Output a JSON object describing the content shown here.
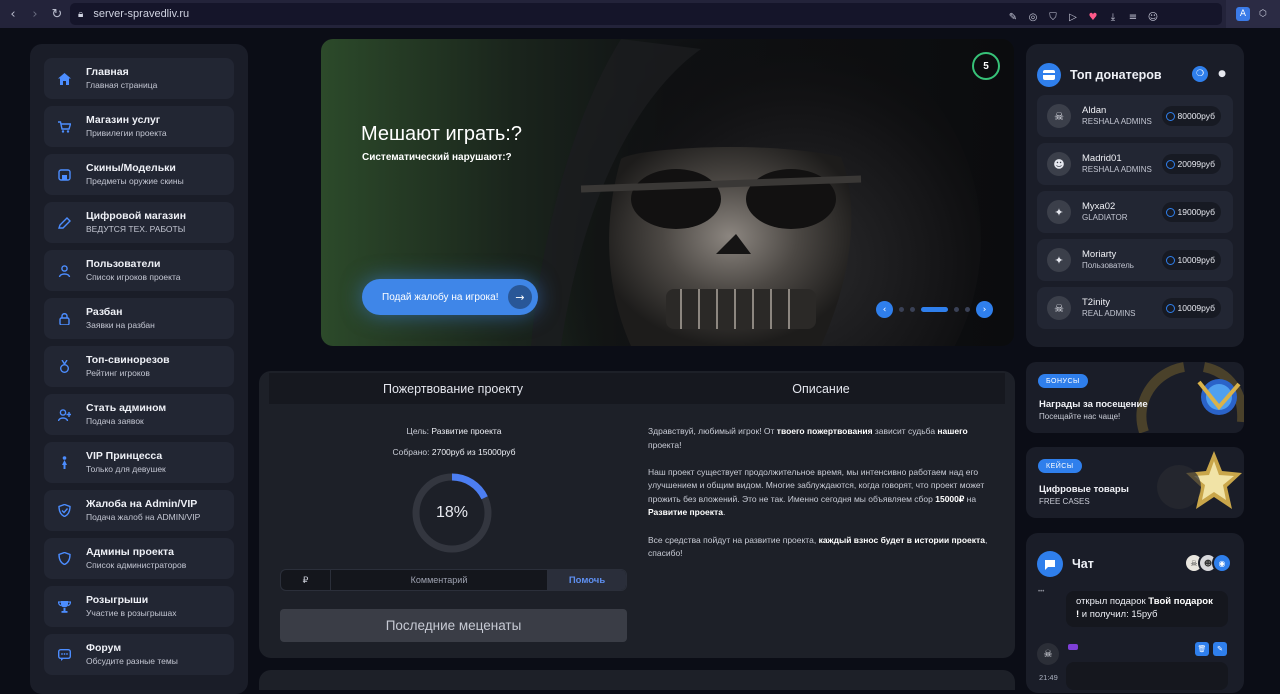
{
  "browser": {
    "url": "server-spravedliv.ru"
  },
  "sidebar": {
    "items": [
      {
        "title": "Главная",
        "subtitle": "Главная страница",
        "icon": "home-icon"
      },
      {
        "title": "Магазин услуг",
        "subtitle": "Привилегии проекта",
        "icon": "cart-icon"
      },
      {
        "title": "Скины/Модельки",
        "subtitle": "Предметы оружие скины",
        "icon": "store-icon"
      },
      {
        "title": "Цифровой магазин",
        "subtitle": "ВЕДУТСЯ ТЕХ. РАБОТЫ",
        "icon": "pencil-icon"
      },
      {
        "title": "Пользователи",
        "subtitle": "Список игроков проекта",
        "icon": "user-icon"
      },
      {
        "title": "Разбан",
        "subtitle": "Заявки на разбан",
        "icon": "lock-icon"
      },
      {
        "title": "Топ-свинорезов",
        "subtitle": "Рейтинг игроков",
        "icon": "medal-icon"
      },
      {
        "title": "Стать админом",
        "subtitle": "Подача заявок",
        "icon": "user-plus-icon"
      },
      {
        "title": "VIP Принцесса",
        "subtitle": "Только для девушек",
        "icon": "figure-icon"
      },
      {
        "title": "Жалоба на Admin/VIP",
        "subtitle": "Подача жалоб на ADMIN/VIP",
        "icon": "shield-check-icon"
      },
      {
        "title": "Админы проекта",
        "subtitle": "Список администраторов",
        "icon": "shield-icon"
      },
      {
        "title": "Розыгрыши",
        "subtitle": "Участие в розыгрышах",
        "icon": "trophy-icon"
      },
      {
        "title": "Форум",
        "subtitle": "Обсудите разные темы",
        "icon": "chat-bubble-icon"
      }
    ]
  },
  "hero": {
    "title": "Мешают играть:?",
    "subtitle": "Систематический нарушают:?",
    "button_label": "Подай жалобу на игрока!",
    "counter": "5",
    "slides_total": 5,
    "slide_active": 3,
    "colors": {
      "accent": "#2f7fec",
      "counter_ring": "#37c278"
    }
  },
  "donation": {
    "tabs": [
      "Пожертвование проекту",
      "Описание"
    ],
    "goal_label": "Цель:",
    "goal_value": "Развитие проекта",
    "collected_label": "Собрано:",
    "collected_value": "2700руб из 15000руб",
    "progress_percent": 18,
    "progress_label": "18%",
    "currency_symbol": "₽",
    "comment_placeholder": "Комментарий",
    "help_button": "Помочь",
    "patrons_button": "Последние меценаты",
    "description": {
      "p1_start": "Здравствуй, любимый игрок! От ",
      "p1_b1": "твоего пожертвования",
      "p1_mid": " зависит судьба ",
      "p1_b2": "нашего",
      "p1_end": " проекта!",
      "p2_start": "Наш проект существует продолжительное время, мы интенсивно работаем над его улучшением и общим видом. Многие заблуждаются, когда говорят, что проект может прожить без вложений. Это не так. Именно сегодня мы объявляем сбор ",
      "p2_b1": "15000₽",
      "p2_mid": " на ",
      "p2_b2": "Развитие проекта",
      "p2_end": ".",
      "p3_start": "Все средства пойдут на развитие проекта, ",
      "p3_b1": "каждый взнос будет в истории проекта",
      "p3_end": ", спасибо!"
    }
  },
  "top_donors": {
    "title": "Топ донатеров",
    "donors": [
      {
        "name": "Aldan",
        "rank": "RESHALA ADMINS",
        "amount": "80000руб"
      },
      {
        "name": "Madrid01",
        "rank": "RESHALA ADMINS",
        "amount": "20099руб"
      },
      {
        "name": "Myxa02",
        "rank": "GLADIATOR",
        "amount": "19000руб"
      },
      {
        "name": "Moriarty",
        "rank": "Пользователь",
        "amount": "10009руб"
      },
      {
        "name": "T2inity",
        "rank": "REAL ADMINS",
        "amount": "10009руб"
      }
    ]
  },
  "promos": [
    {
      "badge": "БОНУСЫ",
      "title": "Награды за посещение",
      "subtitle": "Посещайте нас чаще!"
    },
    {
      "badge": "КЕЙСЫ",
      "title": "Цифровые товары",
      "subtitle": "FREE CASES"
    }
  ],
  "chat": {
    "title": "Чат",
    "message_text_start": "открыл подарок ",
    "message_bold": "Твой подарок !",
    "message_text_end": " и получил: 15руб",
    "message_time": "21:49"
  }
}
